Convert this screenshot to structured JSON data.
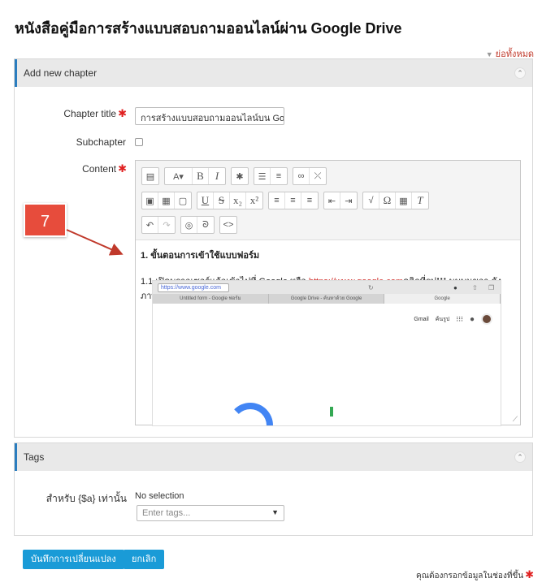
{
  "page": {
    "title": "หนังสือคู่มือการสร้างแบบสอบถามออนไลน์ผ่าน Google Drive",
    "collapse_all": "ย่อทั้งหมด"
  },
  "chapter_section": {
    "header": "Add new chapter",
    "chapter_title_label": "Chapter title",
    "chapter_title_value": "การสร้างแบบสอบถามออนไลน์บน Goo",
    "subchapter_label": "Subchapter",
    "content_label": "Content",
    "content_heading": "1. ขั้นตอนการเข้าใช้แบบฟอร์ม",
    "content_line_prefix": "1.1 เปิดบราวเซอร์แล้วเข้าไปที่ Google หรือ ",
    "content_link": "https://www.google.com",
    "content_line_suffix": "คลิกที่รูป",
    "content_line_tail": " มุมบนขวา ดังภาพ"
  },
  "callout": {
    "number": "7"
  },
  "embedded_screenshot": {
    "url": "https://www.google.com",
    "tabs": [
      "Untitled form - Google ฟอร์ม",
      "Google Drive - ค้นหาด้วย Google",
      "Google"
    ],
    "gmail": "Gmail",
    "images": "ค้นรูป"
  },
  "tags_section": {
    "header": "Tags",
    "label": "สำหรับ {$a} เท่านั้น",
    "selection": "No selection",
    "placeholder": "Enter tags..."
  },
  "buttons": {
    "save": "บันทึกการเปลี่ยนแปลง",
    "cancel": "ยกเลิก"
  },
  "required_note": "คุณต้องกรอกข้อมูลในช่องที่ขึ้น"
}
